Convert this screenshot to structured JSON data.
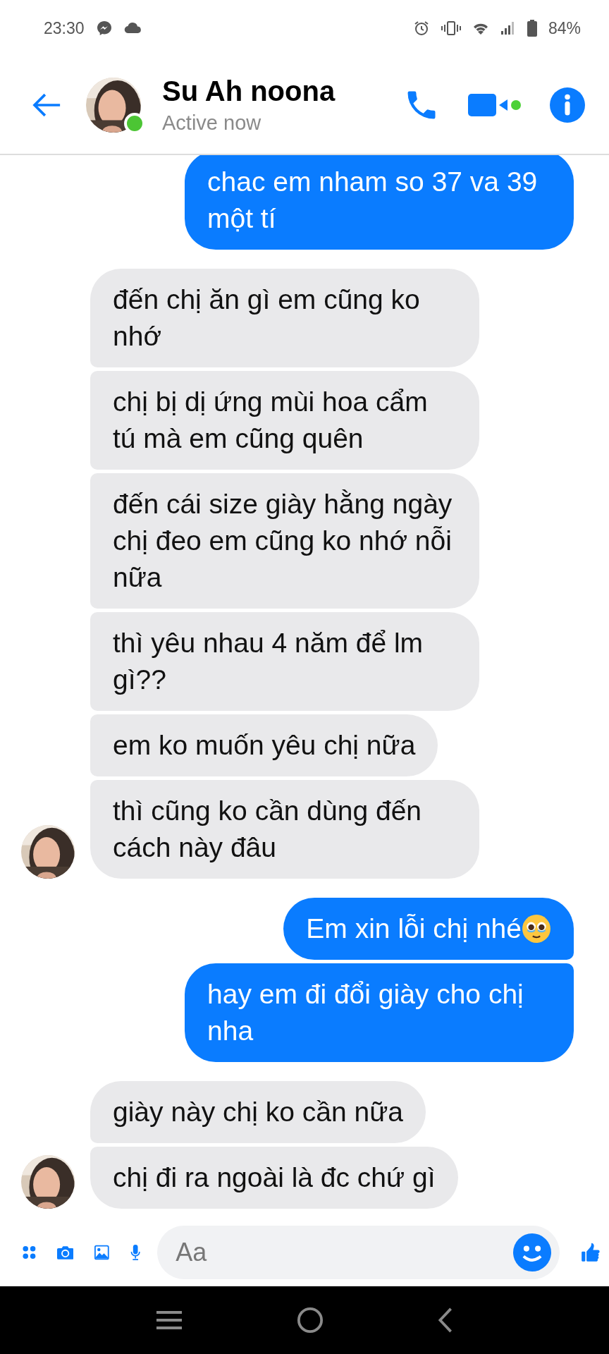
{
  "status_bar": {
    "time": "23:30",
    "battery": "84%"
  },
  "header": {
    "name": "Su Ah noona",
    "status": "Active now",
    "online": true,
    "video_active": true
  },
  "messages": [
    {
      "kind": "outgoing",
      "text": "chac em nham so 37 va 39 một tí",
      "trailing_emoji": false
    },
    {
      "kind": "incoming",
      "text": "đến chị ăn gì em cũng ko nhớ",
      "show_avatar": false
    },
    {
      "kind": "incoming",
      "text": "chị bị dị ứng mùi hoa cẩm tú mà em cũng quên",
      "show_avatar": false
    },
    {
      "kind": "incoming",
      "text": "đến cái size giày hằng ngày chị đeo em cũng ko nhớ nỗi nữa",
      "show_avatar": false
    },
    {
      "kind": "incoming",
      "text": "thì yêu nhau 4 năm để lm gì??",
      "show_avatar": false
    },
    {
      "kind": "incoming",
      "text": "em ko muốn yêu chị nữa",
      "show_avatar": false
    },
    {
      "kind": "incoming",
      "text": "thì cũng ko cần dùng đến cách này đâu",
      "show_avatar": true
    },
    {
      "kind": "outgoing",
      "text": "Em xin lỗi chị nhé",
      "trailing_emoji": true
    },
    {
      "kind": "outgoing",
      "text": "hay em đi đổi giày cho chị nha",
      "trailing_emoji": false
    },
    {
      "kind": "incoming",
      "text": "giày này chị ko cần nữa",
      "show_avatar": false
    },
    {
      "kind": "incoming",
      "text": "chị đi ra ngoài là đc chứ gì",
      "show_avatar": true
    }
  ],
  "composer": {
    "placeholder": "Aa"
  }
}
